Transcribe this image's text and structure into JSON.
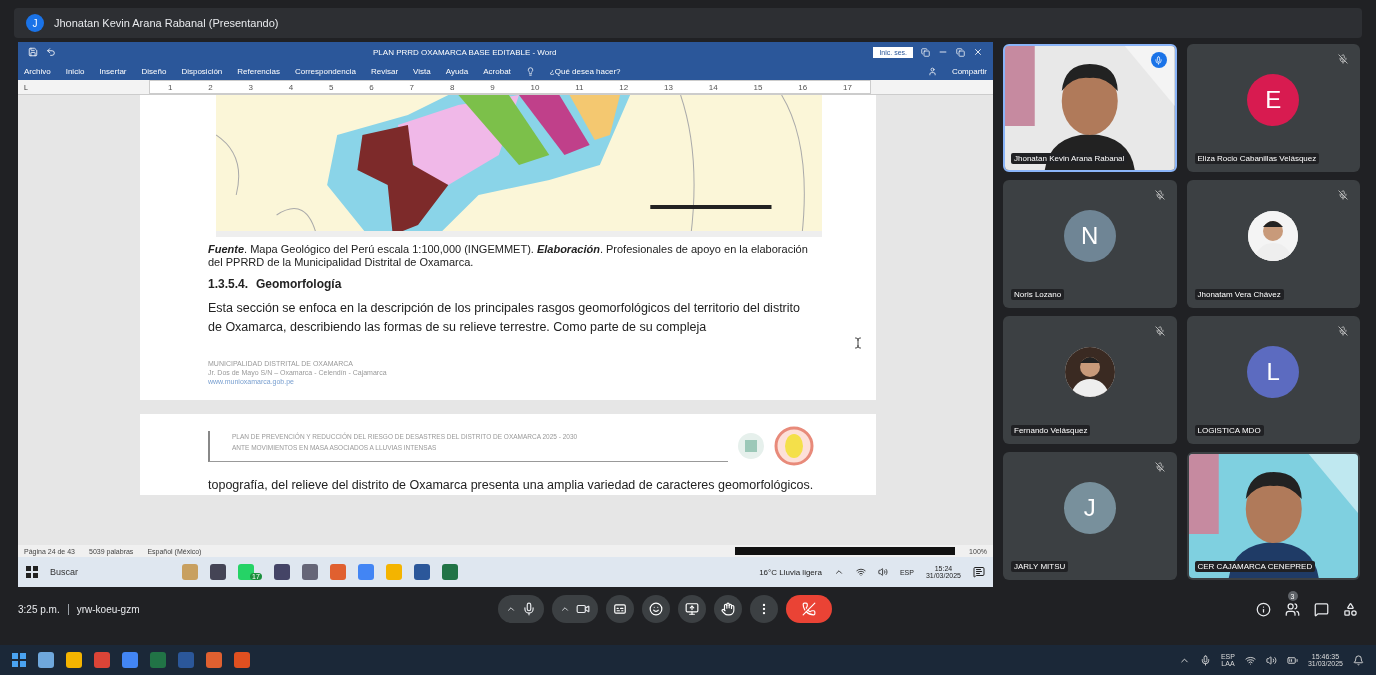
{
  "presenter_bar": {
    "avatar_letter": "J",
    "label": "Jhonatan Kevin Arana Rabanal (Presentando)"
  },
  "shared_screen": {
    "word": {
      "title": "PLAN PRRD OXAMARCA BASE EDITABLE  -  Word",
      "signin": "Inic. ses.",
      "menu": [
        "Archivo",
        "Inicio",
        "Insertar",
        "Diseño",
        "Disposición",
        "Referencias",
        "Correspondencia",
        "Revisar",
        "Vista",
        "Ayuda",
        "Acrobat"
      ],
      "tell_me": "¿Qué desea hacer?",
      "share": "Compartir",
      "ruler_corner": "L",
      "ruler_numbers": [
        "1",
        "2",
        "3",
        "4",
        "5",
        "6",
        "7",
        "8",
        "9",
        "10",
        "11",
        "12",
        "13",
        "14",
        "15",
        "16",
        "17"
      ],
      "page1": {
        "caption": "**Fuente**. Mapa Geológico del Perú escala 1:100,000 (INGEMMET). **Elaboración**. Profesionales de apoyo en la elaboración del PPRRD de la Municipalidad Distrital de Oxamarca.",
        "heading_number": "1.3.5.4.",
        "heading": "Geomorfología",
        "paragraph": "Esta sección se enfoca en la descripción de los principales rasgos geomorfológicos del territorio del distrito de Oxamarca, describiendo las formas de su relieve terrestre. Como parte de su compleja",
        "footer": [
          "MUNICIPALIDAD DISTRITAL DE OXAMARCA",
          "Jr. Dos de Mayo S/N – Oxamarca - Celendín - Cajamarca",
          "www.munioxamarca.gob.pe"
        ]
      },
      "page2": {
        "header": [
          "PLAN DE PREVENCIÓN Y REDUCCIÓN DEL RIESGO DE DESASTRES DEL DISTRITO DE OXAMARCA 2025 - 2030",
          "ANTE MOVIMIENTOS EN MASA ASOCIADOS A LLUVIAS INTENSAS"
        ],
        "paragraph": "topografía, del relieve del distrito de Oxamarca presenta una amplia variedad de caracteres geomorfológicos."
      },
      "status": {
        "page": "Página 24 de 43",
        "words": "5039 palabras",
        "language": "Español (México)",
        "zoom": "100%"
      }
    },
    "taskbar": {
      "search": "Buscar",
      "whatsapp_badge": "17",
      "weather": "16°C  Lluvia ligera",
      "lang": "ESP",
      "time": "15:24",
      "date": "31/03/2025"
    }
  },
  "participants": [
    {
      "name": "Jhonatan Kevin Arana Rabanal",
      "kind": "video",
      "muted": false,
      "selected": true
    },
    {
      "name": "Eliza Rocio Cabanillas Velásquez",
      "kind": "letter",
      "letter": "E",
      "color": "#d81b50",
      "muted": true,
      "selected": false
    },
    {
      "name": "Noris Lozano",
      "kind": "letter",
      "letter": "N",
      "color": "#6f8595",
      "muted": true,
      "selected": false
    },
    {
      "name": "Jhonatam Vera Chávez",
      "muted": true,
      "selected": false
    },
    {
      "name": "Fernando Velásquez",
      "muted": true,
      "selected": false
    },
    {
      "name": "LOGISTICA MDO",
      "kind": "letter",
      "letter": "L",
      "color": "#5c6bc0",
      "muted": true,
      "selected": false
    },
    {
      "name": "JARLY MITSU",
      "kind": "letter",
      "letter": "J",
      "color": "#78909c",
      "muted": true,
      "selected": false
    },
    {
      "name": "CER CAJAMARCA CENEPRED",
      "kind": "video",
      "muted": false,
      "selected": false
    }
  ],
  "meeting_bar": {
    "time": "3:25 p.m.",
    "code": "yrw-koeu-gzm",
    "people_badge": "3"
  },
  "os_taskbar": {
    "lang": "ESP",
    "layout": "LAA",
    "time": "15:46:35",
    "date": "31/03/2025"
  }
}
